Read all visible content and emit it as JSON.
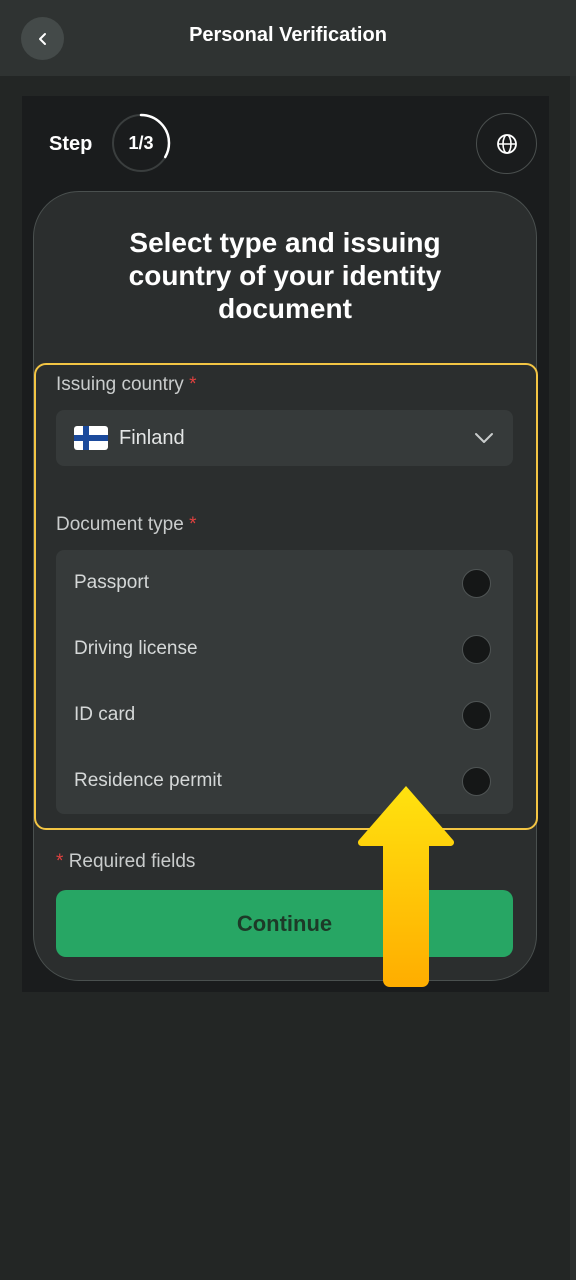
{
  "header": {
    "title": "Personal Verification"
  },
  "step": {
    "label": "Step",
    "counter": "1/3",
    "progress": 0.333
  },
  "card": {
    "title": "Select type and issuing country of your identity document"
  },
  "issuing_country": {
    "label": "Issuing country",
    "required_mark": "*",
    "value": "Finland",
    "flag_icon": "finland-flag-icon"
  },
  "document_type": {
    "label": "Document type",
    "required_mark": "*",
    "options": [
      {
        "label": "Passport",
        "selected": false
      },
      {
        "label": "Driving license",
        "selected": false
      },
      {
        "label": "ID card",
        "selected": false
      },
      {
        "label": "Residence permit",
        "selected": false
      }
    ]
  },
  "footer": {
    "required_mark": "*",
    "required_note": "Required fields",
    "continue_label": "Continue"
  },
  "colors": {
    "accent_green": "#27a664",
    "highlight_yellow": "#f3c544",
    "required_red": "#e0413f"
  }
}
